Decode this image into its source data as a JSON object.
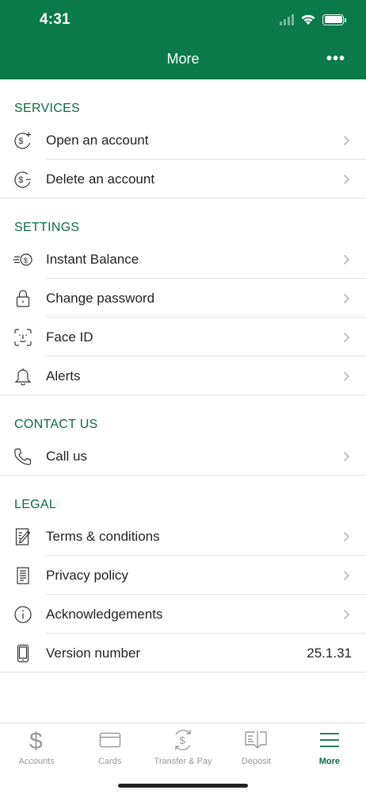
{
  "status": {
    "time": "4:31"
  },
  "header": {
    "title": "More",
    "menu_icon": "more-dots-icon"
  },
  "sections": {
    "services": {
      "title": "SERVICES",
      "items": [
        {
          "label": "Open an account",
          "icon": "dollar-plus-icon"
        },
        {
          "label": "Delete an account",
          "icon": "dollar-minus-icon"
        }
      ]
    },
    "settings": {
      "title": "SETTINGS",
      "items": [
        {
          "label": "Instant Balance",
          "icon": "instant-balance-icon"
        },
        {
          "label": "Change password",
          "icon": "lock-icon"
        },
        {
          "label": "Face ID",
          "icon": "face-id-icon"
        },
        {
          "label": "Alerts",
          "icon": "bell-icon"
        }
      ]
    },
    "contact": {
      "title": "CONTACT US",
      "items": [
        {
          "label": "Call us",
          "icon": "phone-icon"
        }
      ]
    },
    "legal": {
      "title": "LEGAL",
      "items": [
        {
          "label": "Terms & conditions",
          "icon": "document-edit-icon"
        },
        {
          "label": "Privacy policy",
          "icon": "document-icon"
        },
        {
          "label": "Acknowledgements",
          "icon": "info-icon"
        },
        {
          "label": "Version number",
          "icon": "mobile-phone-icon",
          "value": "25.1.31"
        }
      ]
    }
  },
  "tabbar": {
    "tabs": [
      {
        "label": "Accounts",
        "icon": "dollar-icon"
      },
      {
        "label": "Cards",
        "icon": "card-icon"
      },
      {
        "label": "Transfer & Pay",
        "icon": "transfer-icon"
      },
      {
        "label": "Deposit",
        "icon": "deposit-check-icon"
      },
      {
        "label": "More",
        "icon": "hamburger-icon",
        "active": true
      }
    ]
  },
  "colors": {
    "brand_green": "#0b7a4b",
    "section_green": "#0b6b42",
    "inactive_gray": "#999999"
  }
}
